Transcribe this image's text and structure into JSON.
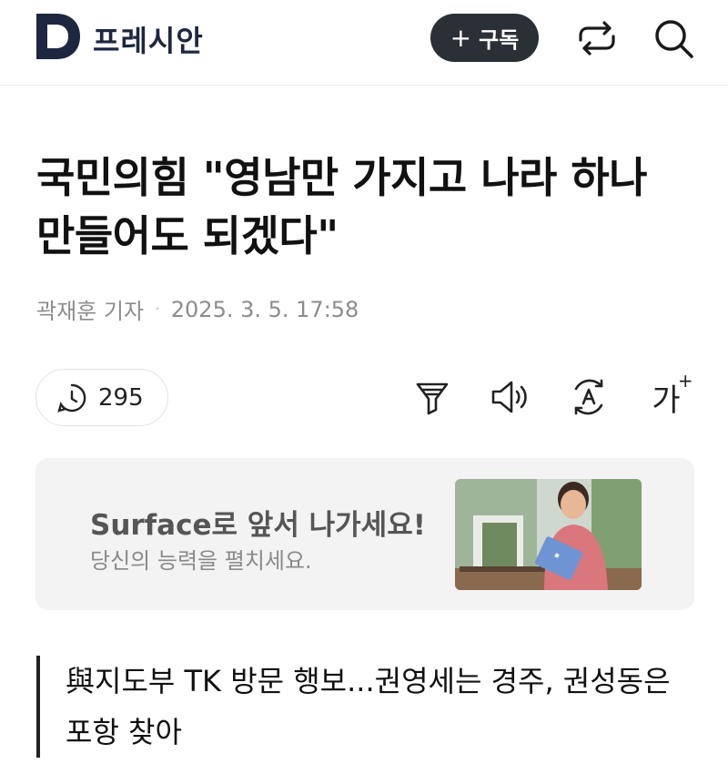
{
  "header": {
    "logo_letter": "D",
    "brand": "프레시안",
    "subscribe_label": "구독",
    "subscribe_plus": "+"
  },
  "article": {
    "title": "국민의힘 \"영남만 가지고 나라 하나 만들어도 되겠다\"",
    "author": "곽재훈 기자",
    "date": "2025. 3. 5. 17:58",
    "views": "295"
  },
  "toolbar": {
    "font_size_label": "가",
    "font_size_plus": "+"
  },
  "ad": {
    "title": "Surface로 앞서 나가세요!",
    "subtitle": "당신의 능력을 펼치세요."
  },
  "related": {
    "text": "與지도부 TK 방문 행보...권영세는 경주, 권성동은 포항 찾아"
  },
  "colors": {
    "brand_navy": "#1e2740",
    "subscribe_bg": "#2b2f36",
    "ad_bg": "#f3f3f4"
  }
}
